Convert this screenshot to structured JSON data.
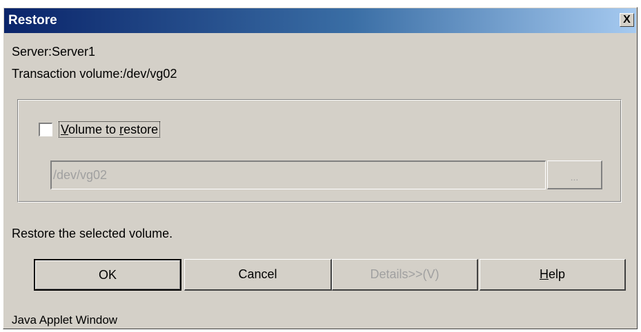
{
  "window": {
    "title": "Restore",
    "close_glyph": "X"
  },
  "info": {
    "server": "Server:Server1",
    "transaction_volume": "Transaction volume:/dev/vg02"
  },
  "restore_group": {
    "checkbox_prefix": "V",
    "checkbox_middle": "olume to ",
    "checkbox_underlined": "r",
    "checkbox_suffix": "estore",
    "checked": false,
    "path_value": "/dev/vg02",
    "browse_label": "..."
  },
  "message": "Restore the selected volume.",
  "buttons": {
    "ok": "OK",
    "cancel": "Cancel",
    "details": "Details>>(V)",
    "help_prefix": "",
    "help_underlined": "H",
    "help_suffix": "elp"
  },
  "footer": "Java Applet Window",
  "icons": {
    "close": "close-icon"
  },
  "colors": {
    "titlebar_start": "#0a246a",
    "titlebar_end": "#a6caf0",
    "dialog_bg": "#d4d0c8",
    "disabled_text": "#a0a0a0"
  }
}
